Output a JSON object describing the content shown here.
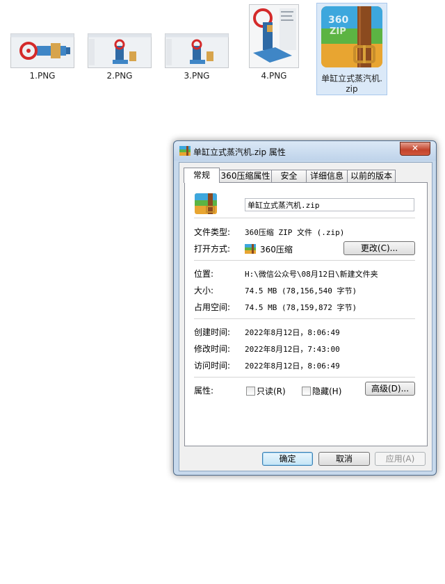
{
  "desktop": {
    "files": [
      {
        "name": "1.PNG"
      },
      {
        "name": "2.PNG"
      },
      {
        "name": "3.PNG"
      },
      {
        "name": "4.PNG"
      },
      {
        "name": "单缸立式蒸汽机.zip",
        "name_line1": "单缸立式蒸汽机.",
        "name_line2": "zip",
        "icon_text": "360\nZIP"
      }
    ]
  },
  "dialog": {
    "title": "单缸立式蒸汽机.zip 属性",
    "close_label": "✕",
    "tabs": [
      {
        "label": "常规",
        "active": true
      },
      {
        "label": "360压缩属性"
      },
      {
        "label": "安全"
      },
      {
        "label": "详细信息"
      },
      {
        "label": "以前的版本"
      }
    ],
    "file_name": "单缸立式蒸汽机.zip",
    "fields": {
      "type_label": "文件类型:",
      "type_value": "360压缩 ZIP 文件 (.zip)",
      "open_label": "打开方式:",
      "open_value": "360压缩",
      "change_button": "更改(C)...",
      "location_label": "位置:",
      "location_value": "H:\\微信公众号\\08月12日\\新建文件夹",
      "size_label": "大小:",
      "size_value": "74.5 MB (78,156,540 字节)",
      "disk_label": "占用空间:",
      "disk_value": "74.5 MB (78,159,872 字节)",
      "created_label": "创建时间:",
      "created_value": "2022年8月12日，8:06:49",
      "modified_label": "修改时间:",
      "modified_value": "2022年8月12日，7:43:00",
      "accessed_label": "访问时间:",
      "accessed_value": "2022年8月12日，8:06:49",
      "attr_label": "属性:",
      "readonly_label": "只读(R)",
      "hidden_label": "隐藏(H)",
      "advanced_button": "高级(D)..."
    },
    "buttons": {
      "ok": "确定",
      "cancel": "取消",
      "apply": "应用(A)"
    }
  }
}
